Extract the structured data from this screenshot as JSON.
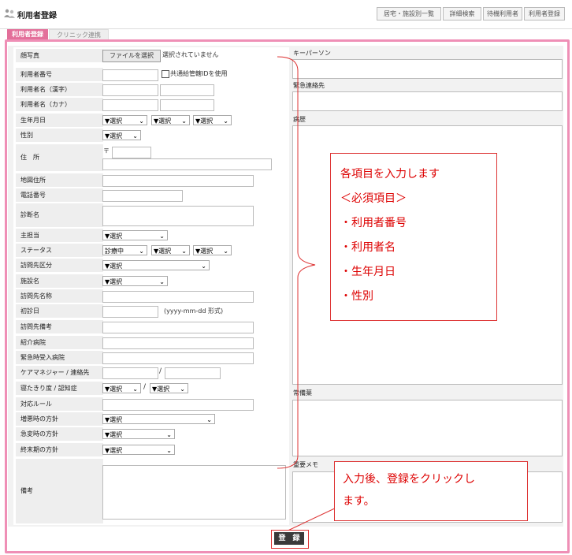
{
  "header": {
    "title": "利用者登録"
  },
  "topnav": [
    "居宅・施設別一覧",
    "詳細検索",
    "待機利用者",
    "利用者登録"
  ],
  "tabs": [
    "利用者登録",
    "クリニック連携"
  ],
  "form": {
    "photo_label": "顔写真",
    "file_button": "ファイルを選択",
    "file_status": "選択されていません",
    "user_number": "利用者番号",
    "shared_id_label": "共通給管轄IDを使用",
    "name_kanji": "利用者名（漢字）",
    "name_kana": "利用者名（カナ）",
    "birthday": "生年月日",
    "gender": "性別",
    "address": "住　所",
    "postal_mark": "〒",
    "map_address": "地図住所",
    "phone": "電話番号",
    "diagnosis": "診断名",
    "main_staff": "主担当",
    "status": "ステータス",
    "visit_type": "訪問先区分",
    "facility": "施設名",
    "visit_name": "訪問先名称",
    "first_visit": "初診日",
    "date_hint": "(yyyy-mm-dd 形式)",
    "visit_note": "訪問先備考",
    "referral": "紹介病院",
    "emergency_hospital": "緊急時受入病院",
    "care_manager": "ケアマネジャー / 連絡先",
    "slash": "/",
    "bedridden": "寝たきり度 / 認知症",
    "rules": "対応ルール",
    "worsening": "増悪時の方針",
    "sudden": "急変時の方針",
    "terminal": "終末期の方針",
    "notes": "備考",
    "select_default": "▼選択",
    "status_value": "診療中"
  },
  "right": {
    "key_person": "キーパーソン",
    "emergency_contact": "緊急連絡先",
    "history": "病歴",
    "regular_meds": "常備薬",
    "important_memo": "重要メモ"
  },
  "callout1": {
    "lines": [
      "各項目を入力します",
      "＜必須項目＞",
      "・利用者番号",
      "・利用者名",
      "・生年月日",
      "・性別"
    ]
  },
  "callout2": {
    "lines": [
      "入力後、登録をクリックし",
      "ます。"
    ]
  },
  "submit_label": "登　録",
  "colors": {
    "accent": "#e36f9a",
    "frame": "#ef8fb6",
    "callout": "#d00000"
  }
}
